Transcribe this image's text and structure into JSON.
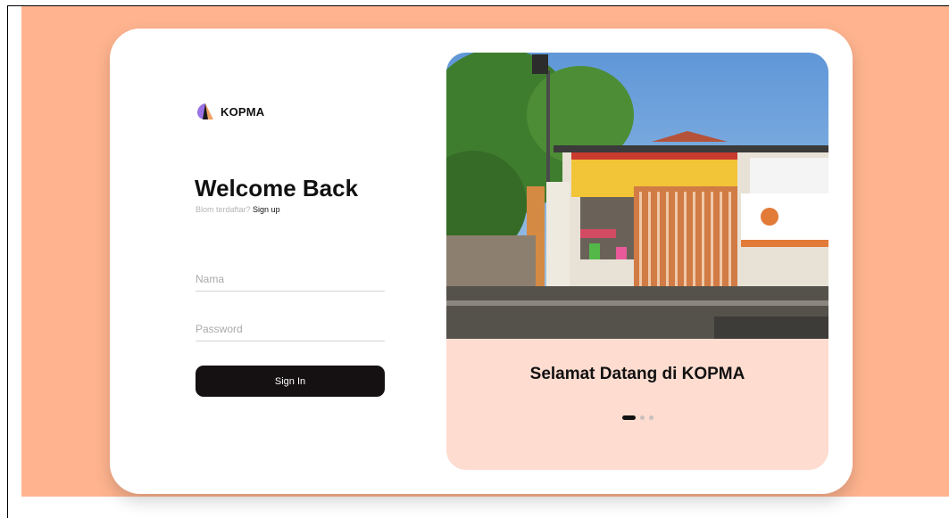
{
  "brand": {
    "name": "KOPMA",
    "icon": "kopma-logo-icon"
  },
  "login": {
    "title": "Welcome Back",
    "signup_prompt": "Blom terdaftar?",
    "signup_link": "Sign up",
    "name_placeholder": "Nama",
    "password_placeholder": "Password",
    "signin_label": "Sign In"
  },
  "carousel": {
    "caption": "Selamat Datang di KOPMA",
    "slide_count": 3,
    "active_slide": 1
  },
  "colors": {
    "background": "#ffb48f",
    "panel": "#fedcd0",
    "button": "#151112",
    "logo_purple": "#9a72e6",
    "logo_orange": "#f0a266"
  }
}
